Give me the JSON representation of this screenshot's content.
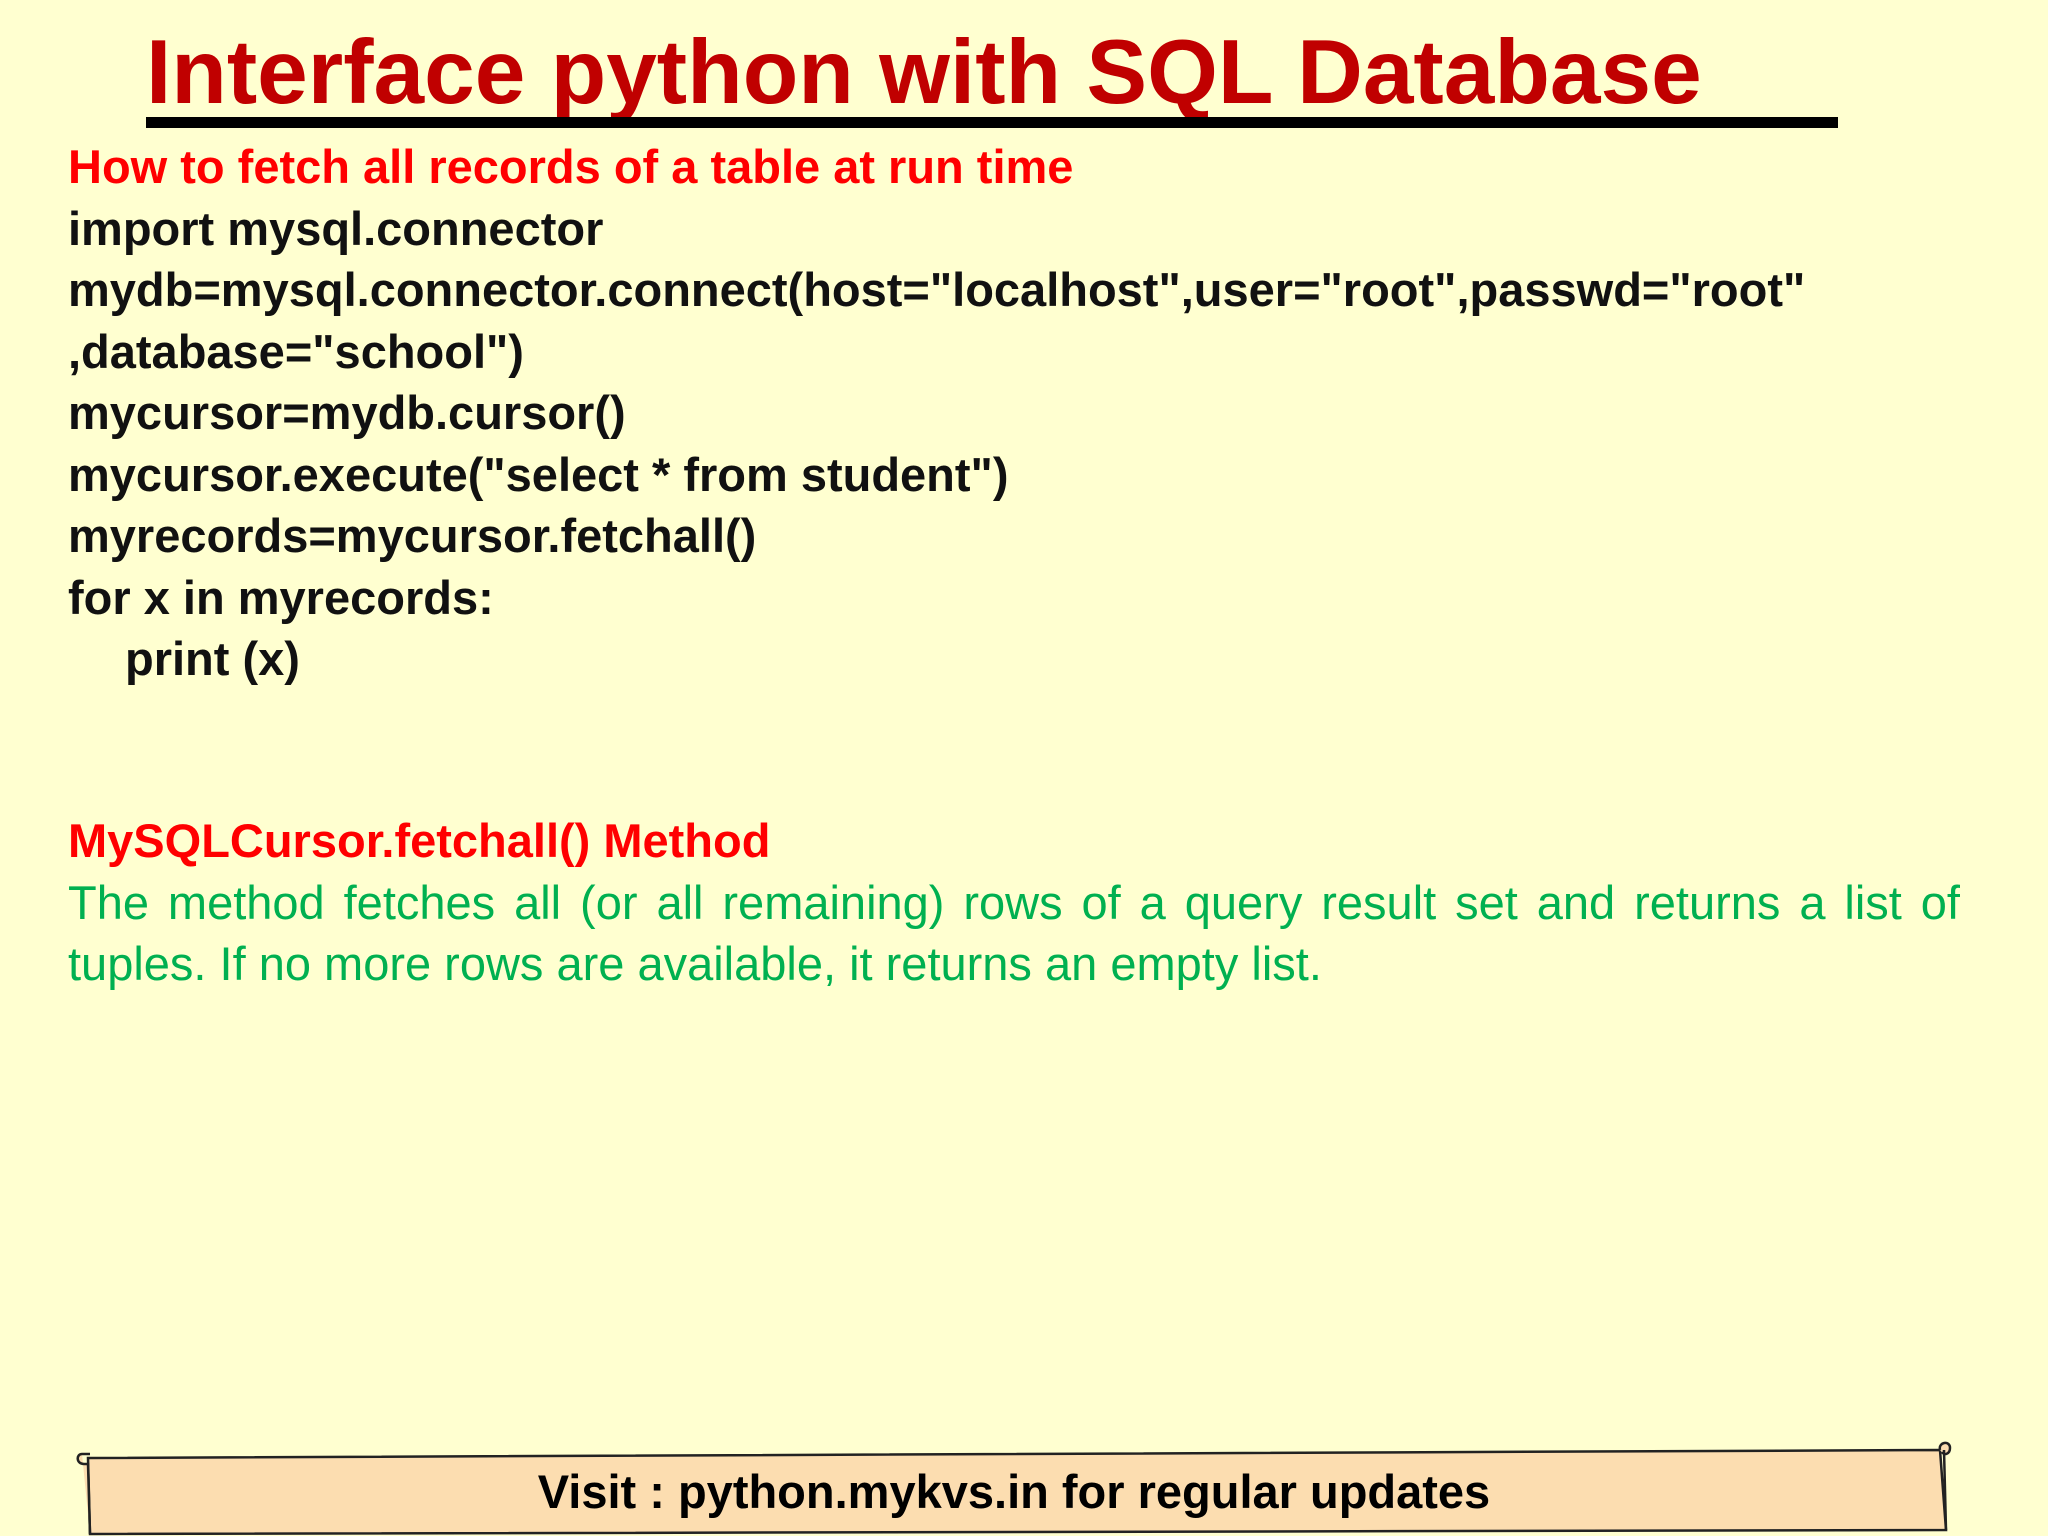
{
  "slide": {
    "title": "Interface python with SQL Database",
    "subtitle": "How to fetch all records of a table at run time",
    "code_lines": [
      "import mysql.connector",
      "mydb=mysql.connector.connect(host=\"localhost\",user=\"root\",passwd=\"root\"",
      ",database=\"school\")",
      "mycursor=mydb.cursor()",
      "mycursor.execute(\"select * from student\")",
      "myrecords=mycursor.fetchall()",
      "for x in myrecords:",
      "print (x)"
    ],
    "method_heading": "MySQLCursor.fetchall() Method",
    "method_description": "The method fetches all (or all remaining) rows of a query result set and returns a list of tuples. If no more rows are available, it returns an empty list."
  },
  "footer": {
    "banner_text": "Visit : python.mykvs.in for regular updates"
  },
  "colors": {
    "background": "#FFFFD0",
    "title": "#C00000",
    "heading_red": "#FF0000",
    "description_green": "#00B050",
    "banner_fill": "#FCDDB0"
  }
}
